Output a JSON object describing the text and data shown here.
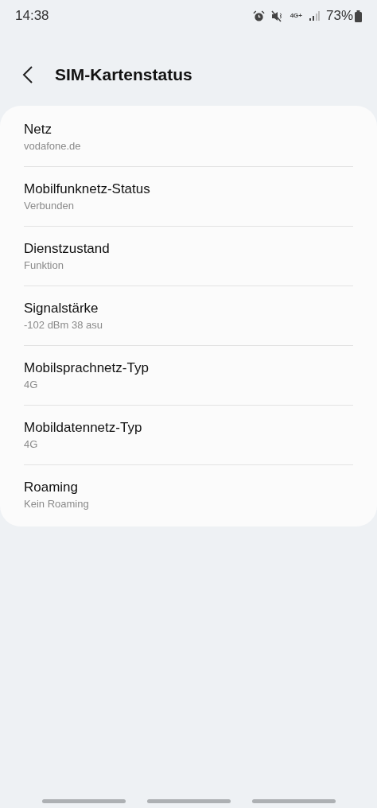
{
  "status_bar": {
    "time": "14:38",
    "network": "4G+",
    "battery": "73%"
  },
  "header": {
    "title": "SIM-Kartenstatus"
  },
  "items": [
    {
      "title": "Netz",
      "value": "vodafone.de"
    },
    {
      "title": "Mobilfunknetz-Status",
      "value": "Verbunden"
    },
    {
      "title": "Dienstzustand",
      "value": "Funktion"
    },
    {
      "title": "Signalstärke",
      "value": "-102 dBm 38 asu"
    },
    {
      "title": "Mobilsprachnetz-Typ",
      "value": "4G"
    },
    {
      "title": "Mobildatennetz-Typ",
      "value": "4G"
    },
    {
      "title": "Roaming",
      "value": "Kein Roaming"
    }
  ]
}
